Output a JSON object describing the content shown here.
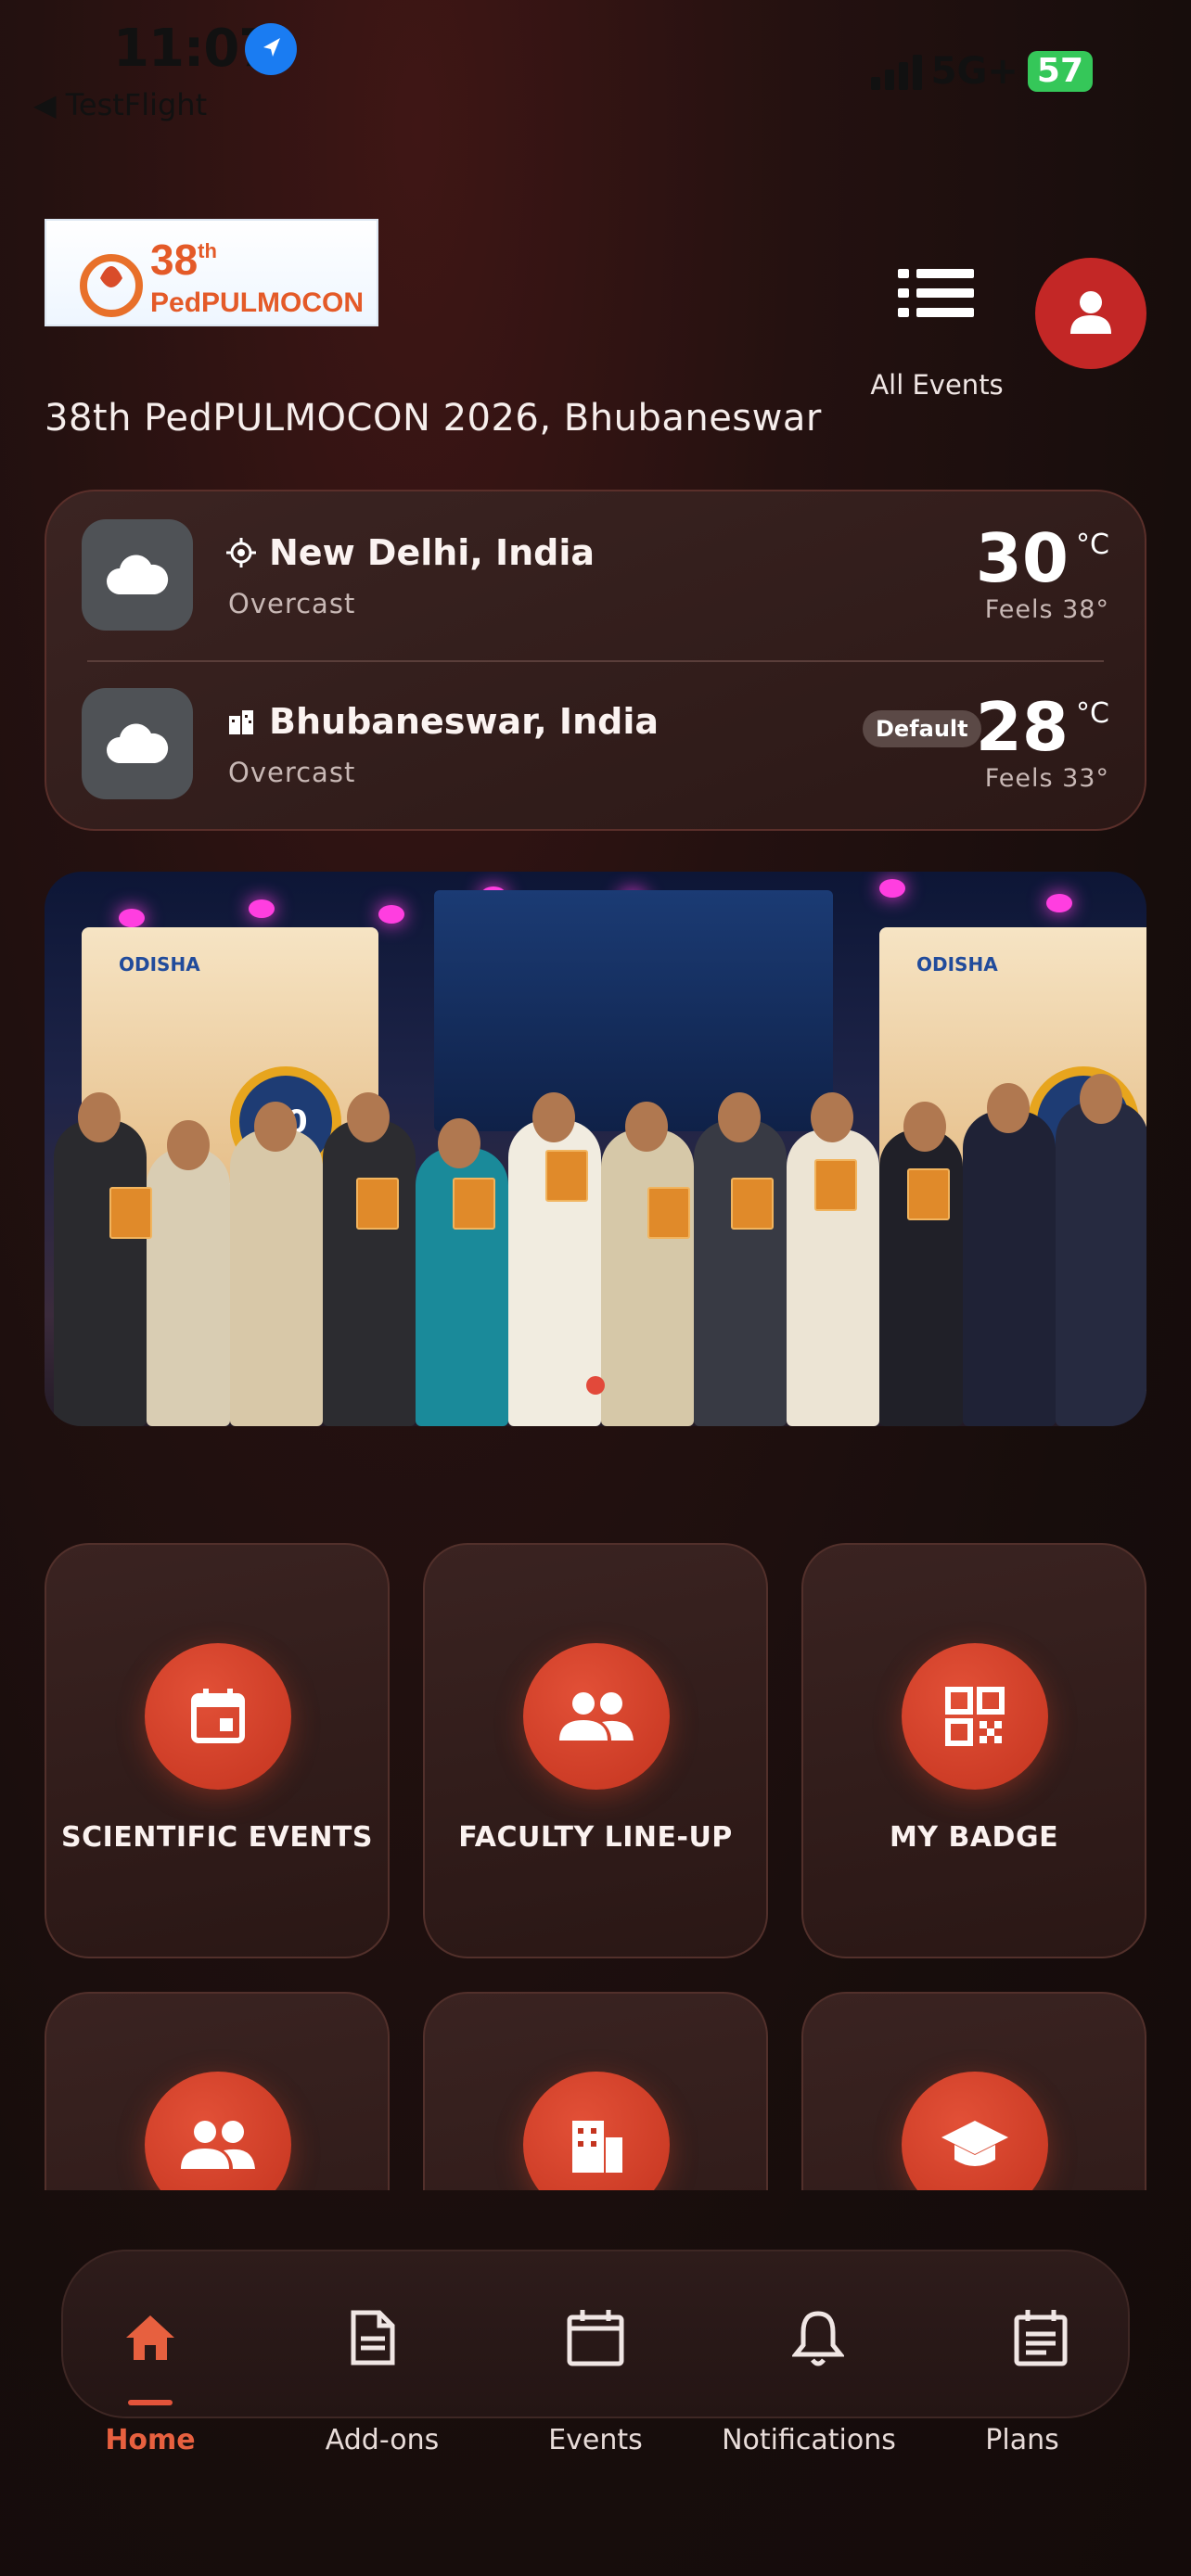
{
  "status_bar": {
    "time": "11:07",
    "back_app": "◀ TestFlight",
    "network": "5G+",
    "battery": "57"
  },
  "header": {
    "logo_text": "38th PedPULMOCON",
    "all_events_label": "All Events",
    "title": "38th PedPULMOCON 2026, Bhubaneswar"
  },
  "weather": [
    {
      "city": "New Delhi, India",
      "condition": "Overcast",
      "temp": "30",
      "unit": "°C",
      "feels": "Feels 38°",
      "default_badge": ""
    },
    {
      "city": "Bhubaneswar, India",
      "condition": "Overcast",
      "temp": "28",
      "unit": "°C",
      "feels": "Feels 33°",
      "default_badge": "Default"
    }
  ],
  "banner": {
    "panel_brand": "ODISHA",
    "panel_word": "odisha",
    "panel_badge": "40"
  },
  "tiles": [
    {
      "label": "SCIENTIFIC EVENTS",
      "icon": "calendar-icon"
    },
    {
      "label": "FACULTY LINE-UP",
      "icon": "people-icon"
    },
    {
      "label": "MY BADGE",
      "icon": "qr-code-icon"
    },
    {
      "label": "",
      "icon": "group-icon"
    },
    {
      "label": "",
      "icon": "building-icon"
    },
    {
      "label": "",
      "icon": "graduation-cap-icon"
    }
  ],
  "nav": {
    "items": [
      {
        "label": "Home",
        "icon": "home-icon",
        "active": true
      },
      {
        "label": "Add-ons",
        "icon": "document-icon"
      },
      {
        "label": "Events",
        "icon": "calendar-icon"
      },
      {
        "label": "Notifications",
        "icon": "bell-icon"
      },
      {
        "label": "Plans",
        "icon": "plans-icon"
      }
    ]
  },
  "colors": {
    "accent": "#e2533a",
    "background": "#170d0c",
    "card": "#2e1a18"
  }
}
